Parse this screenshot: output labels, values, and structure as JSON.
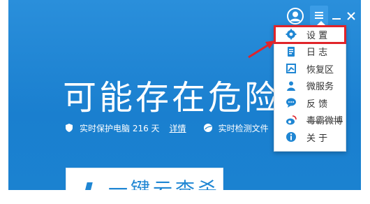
{
  "window": {
    "headline": "可能存在危险",
    "status": {
      "protect_text": "实时保护电脑 216 天",
      "detail_link": "详情",
      "detect_text": "实时检测文件"
    },
    "action_button": "一键云查杀"
  },
  "menu": {
    "items": [
      {
        "label": "设 置",
        "icon": "gear-icon"
      },
      {
        "label": "日 志",
        "icon": "log-book-icon"
      },
      {
        "label": "恢复区",
        "icon": "restore-flag-icon"
      },
      {
        "label": "微服务",
        "icon": "microservice-person-icon"
      },
      {
        "label": "反 馈",
        "icon": "feedback-bubble-icon"
      },
      {
        "label": "毒霸微博",
        "icon": "weibo-icon"
      },
      {
        "label": "关 于",
        "icon": "info-icon"
      }
    ]
  },
  "colors": {
    "accent": "#1f86d3",
    "highlight": "#e0242a",
    "menu_icon": "#1f86d3"
  }
}
